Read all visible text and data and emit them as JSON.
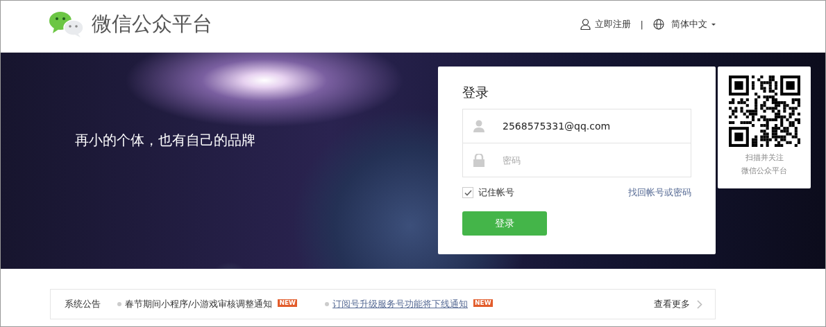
{
  "header": {
    "brand": "微信公众平台",
    "register": "立即注册",
    "separator": "|",
    "language": "简体中文"
  },
  "banner": {
    "slogan": "再小的个体，也有自己的品牌"
  },
  "login": {
    "title": "登录",
    "account": {
      "value": "2568575331@qq.com"
    },
    "password": {
      "placeholder": "密码"
    },
    "remember": {
      "label": "记住帐号",
      "checked": true
    },
    "recover": "找回帐号或密码",
    "submit": "登录"
  },
  "qr": {
    "caption": [
      "扫描并关注",
      "微信公众平台"
    ]
  },
  "notices": {
    "label": "系统公告",
    "items": [
      {
        "text": "春节期间小程序/小游戏审核调整通知",
        "badge": "NEW",
        "underlined": false
      },
      {
        "text": "订阅号升级服务号功能将下线通知",
        "badge": "NEW",
        "underlined": true
      }
    ],
    "more": "查看更多"
  }
}
